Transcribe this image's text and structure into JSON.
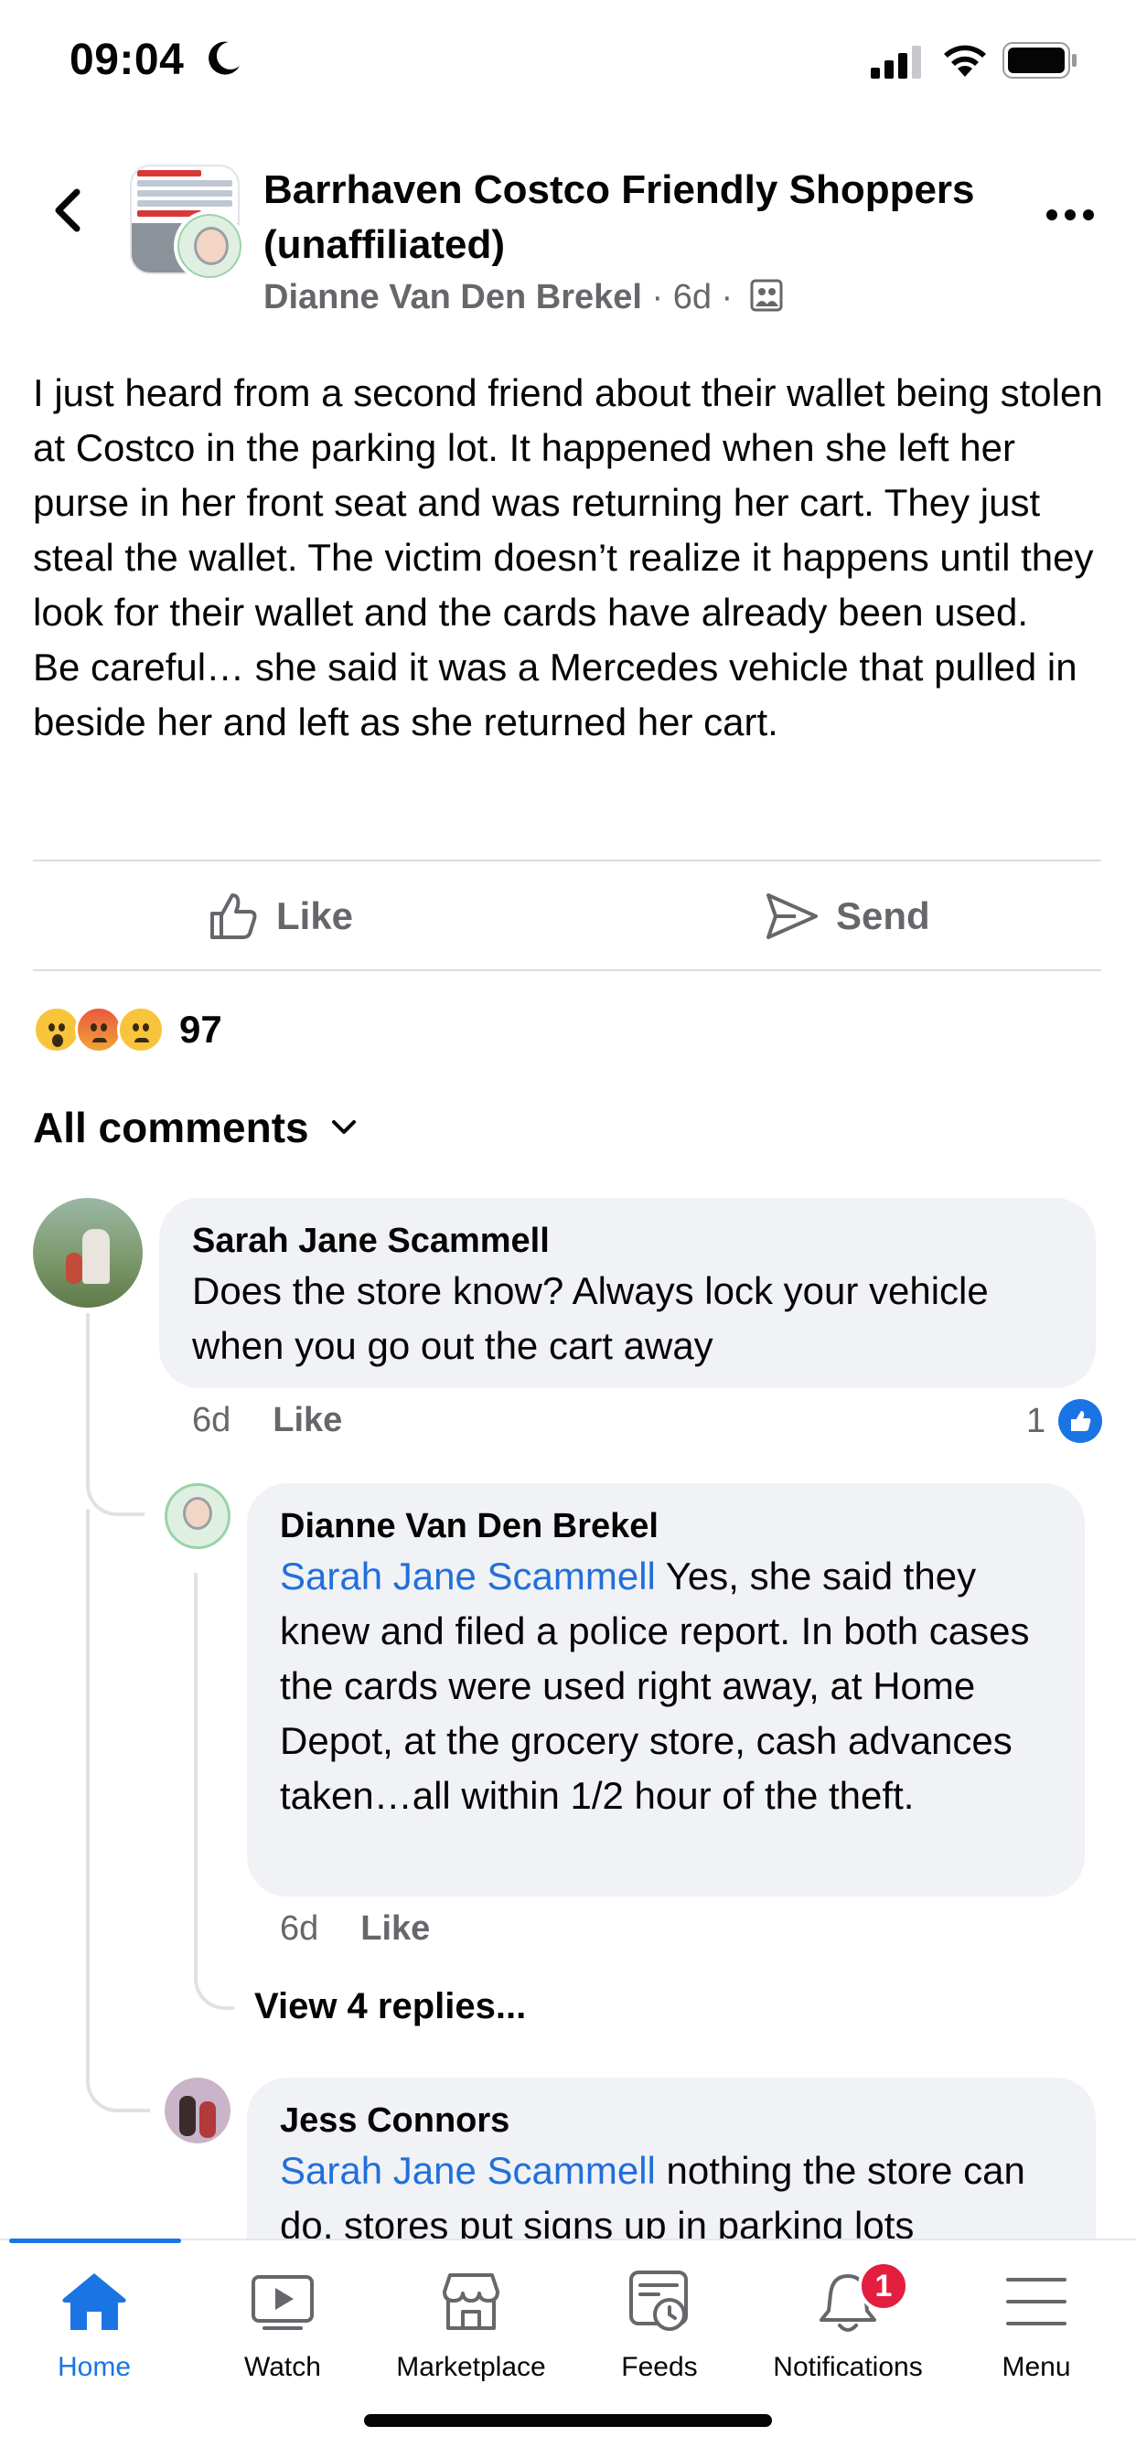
{
  "status_bar": {
    "time": "09:04"
  },
  "header": {
    "group_name": "Barrhaven Costco Friendly Shoppers (unaffiliated)",
    "author": "Dianne Van Den Brekel",
    "separator": "·",
    "age": "6d"
  },
  "post": {
    "text": "I just heard from a second friend about their wallet being stolen at Costco in the parking lot. It happened when she left her purse in her front seat and was returning her cart. They just steal the wallet. The victim doesn’t realize it happens until they look for their wallet and the cards have already been used.\nBe careful… she said it was a Mercedes vehicle that pulled in beside her and left as she returned her cart.",
    "like_label": "Like",
    "send_label": "Send",
    "reaction_count": "97",
    "reactions": [
      "wow",
      "angry",
      "sad"
    ]
  },
  "comments_header": {
    "label": "All comments"
  },
  "comments": [
    {
      "name": "Sarah Jane Scammell",
      "text": "Does the store know? Always lock your vehicle when you go out the cart away",
      "age": "6d",
      "like_label": "Like",
      "like_count": "1"
    },
    {
      "name": "Dianne Van Den Brekel",
      "mention": "Sarah Jane Scammell",
      "text": " Yes, she said they knew and filed a police report. In both cases the cards were used right away, at Home Depot, at the grocery store, cash advances taken…all within 1/2 hour of the theft.",
      "age": "6d",
      "like_label": "Like"
    },
    {
      "name": "Jess Connors",
      "mention": "Sarah Jane Scammell",
      "text": " nothing the store can do, stores put signs up in parking lots"
    }
  ],
  "view_replies": "View 4 replies...",
  "tabbar": {
    "items": [
      {
        "label": "Home",
        "icon": "home-icon",
        "active": true
      },
      {
        "label": "Watch",
        "icon": "watch-icon"
      },
      {
        "label": "Marketplace",
        "icon": "marketplace-icon"
      },
      {
        "label": "Feeds",
        "icon": "feeds-icon"
      },
      {
        "label": "Notifications",
        "icon": "bell-icon",
        "badge": "1"
      },
      {
        "label": "Menu",
        "icon": "menu-icon"
      }
    ]
  },
  "colors": {
    "accent": "#1b74e4",
    "mention": "#216fdb",
    "secondary_text": "#65676b",
    "bubble": "#f0f2f5",
    "badge": "#e41e3f"
  }
}
